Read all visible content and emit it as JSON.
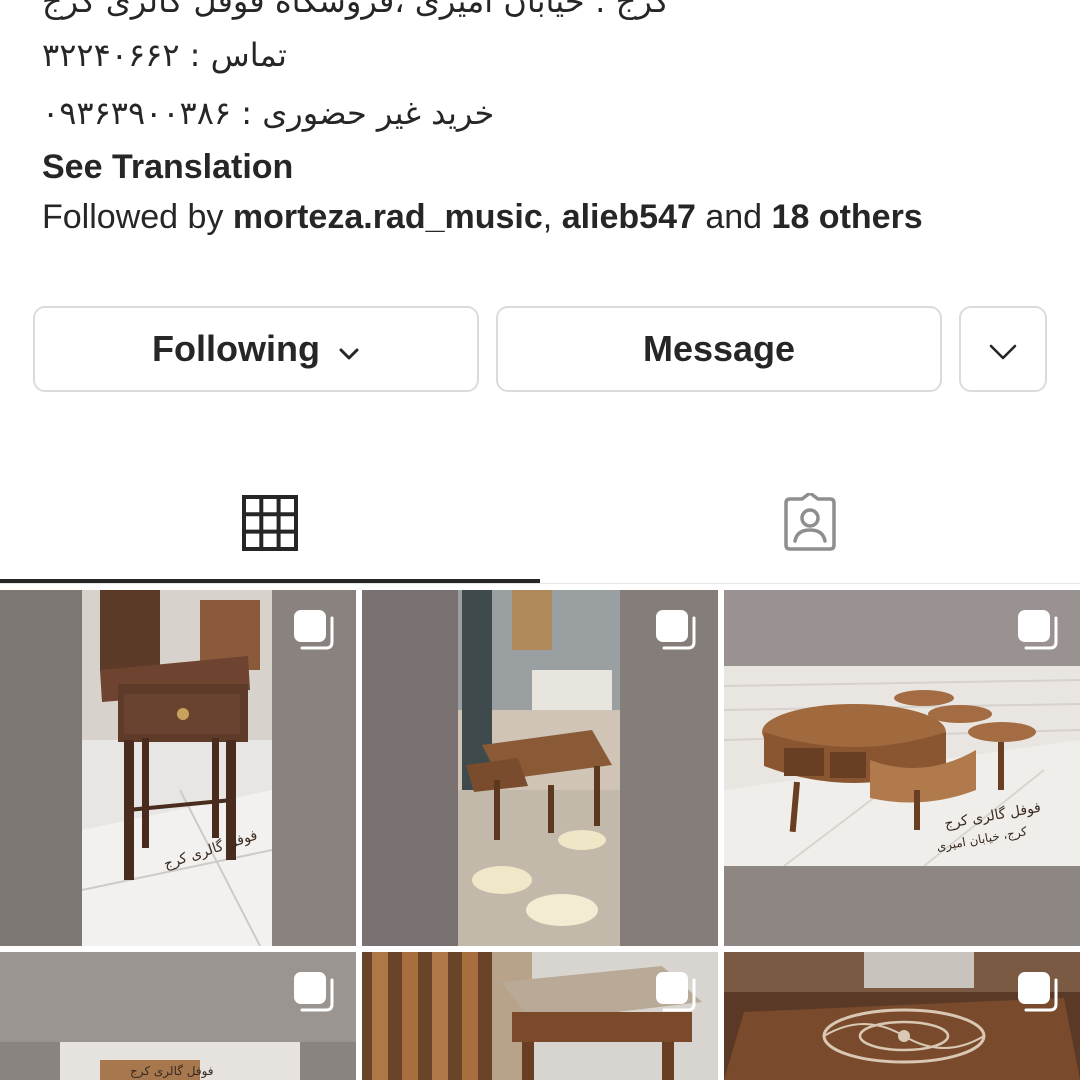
{
  "bio": {
    "address_line_partial": "کرج : خیابان امیری ،فروشگاه فوفل گالری کرج",
    "contact_line": "تماس : ۳۲۲۴۰۶۶۲",
    "online_order_line": "خرید غیر حضوری : ۰۹۳۶۳۹۰۰۳۸۶",
    "see_translation": "See Translation"
  },
  "followed_by": {
    "prefix": "Followed by",
    "user1": "morteza.rad_music",
    "separator": ",",
    "user2": "alieb547",
    "connector": "and",
    "others": "18 others"
  },
  "actions": {
    "following_label": "Following",
    "message_label": "Message"
  },
  "tabs": {
    "grid_icon": "grid-icon",
    "tagged_icon": "tagged-person-icon",
    "active": "grid"
  },
  "posts": {
    "watermark_1": "فوفل گالری کرج",
    "watermark_3a": "فوفل گالری کرج",
    "watermark_3b": "کرج، خیابان امیری",
    "watermark_5": "فوفل گالری کرج",
    "multi_icon": "carousel-icon"
  }
}
